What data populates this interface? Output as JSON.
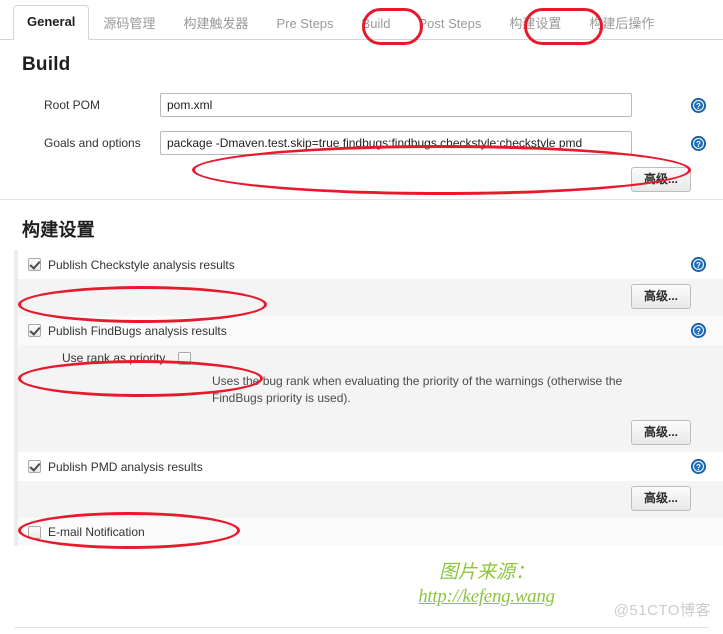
{
  "tabs": [
    {
      "label": "General",
      "active": true,
      "highlighted": false
    },
    {
      "label": "源码管理",
      "active": false,
      "highlighted": false
    },
    {
      "label": "构建触发器",
      "active": false,
      "highlighted": false
    },
    {
      "label": "Pre Steps",
      "active": false,
      "highlighted": false
    },
    {
      "label": "Build",
      "active": false,
      "highlighted": true
    },
    {
      "label": "Post Steps",
      "active": false,
      "highlighted": false
    },
    {
      "label": "构建设置",
      "active": false,
      "highlighted": true
    },
    {
      "label": "构建后操作",
      "active": false,
      "highlighted": false
    }
  ],
  "build_section": {
    "title": "Build",
    "rows": [
      {
        "label": "Root POM",
        "value": "pom.xml",
        "placeholder": "",
        "help": "help-icon"
      },
      {
        "label": "Goals and options",
        "value": "package -Dmaven.test.skip=true findbugs:findbugs checkstyle:checkstyle pmd",
        "placeholder": "",
        "help": "help-icon"
      }
    ],
    "advanced_label": "高级..."
  },
  "settings_section": {
    "title": "构建设置",
    "advanced_label": "高级...",
    "items": [
      {
        "id": "checkstyle",
        "label": "Publish Checkstyle analysis results",
        "checked": true
      },
      {
        "id": "findbugs",
        "label": "Publish FindBugs analysis results",
        "checked": true,
        "sub_label": "Use rank as priority",
        "sub_checked": false,
        "sub_description": "Uses the bug rank when evaluating the priority of the warnings (otherwise the FindBugs priority is used)."
      },
      {
        "id": "pmd",
        "label": "Publish PMD analysis results",
        "checked": true
      },
      {
        "id": "email",
        "label": "E-mail Notification",
        "checked": false
      }
    ]
  },
  "watermark": {
    "line1": "图片来源：",
    "line2": "http://kefeng.wang",
    "corner": "@51CTO博客",
    "color": "#8cc63f",
    "corner_color": "#cccccc"
  },
  "annotation": {
    "color": "#e8192c"
  }
}
